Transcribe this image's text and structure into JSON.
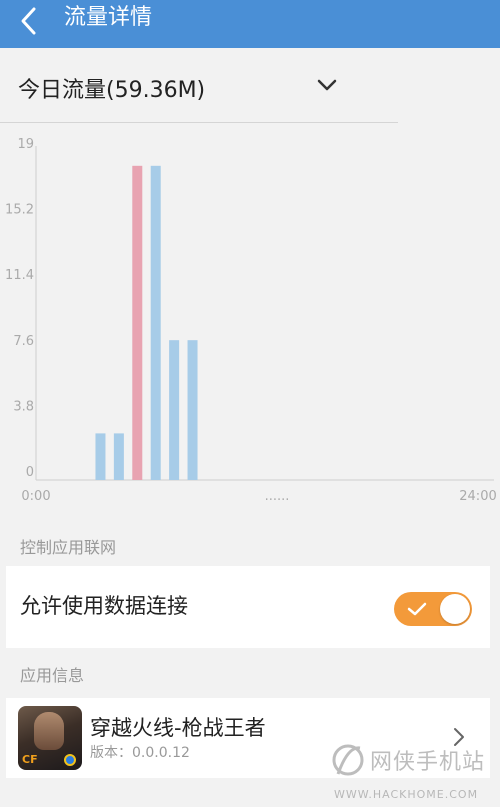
{
  "header": {
    "title": "流量详情",
    "back_icon": "chevron-left-icon"
  },
  "dropdown": {
    "label": "今日流量(59.36M)",
    "icon": "chevron-down-icon"
  },
  "chart_data": {
    "type": "bar",
    "title": "",
    "xlabel": "",
    "ylabel": "",
    "y_ticks": [
      "0",
      "3.8",
      "7.6",
      "11.4",
      "15.2",
      "19"
    ],
    "ylim": [
      0,
      19
    ],
    "x_tick_labels": [
      "0:00",
      "......",
      "24:00"
    ],
    "xlim": [
      0,
      24
    ],
    "bars": [
      {
        "hour": 3,
        "value": 2.7,
        "color": "#a7cce8"
      },
      {
        "hour": 4,
        "value": 2.7,
        "color": "#a7cce8"
      },
      {
        "hour": 5,
        "value": 18.2,
        "color": "#e8a3b1"
      },
      {
        "hour": 6,
        "value": 18.2,
        "color": "#a7cce8"
      },
      {
        "hour": 7,
        "value": 8.1,
        "color": "#a7cce8"
      },
      {
        "hour": 8,
        "value": 8.1,
        "color": "#a7cce8"
      }
    ],
    "colors": {
      "normal": "#a7cce8",
      "highlight": "#e8a3b1"
    }
  },
  "network_section": {
    "title": "控制应用联网",
    "toggle_label": "允许使用数据连接",
    "toggle_on": true,
    "toggle_color": "#f39a3a"
  },
  "app_section": {
    "title": "应用信息",
    "app_name": "穿越火线-枪战王者",
    "version": "版本：0.0.0.12",
    "icon_text": "CF"
  },
  "watermark": {
    "text": "网侠手机站",
    "url": "WWW.HACKHOME.COM"
  },
  "colors": {
    "header": "#4a8fd6",
    "background": "#f2f2f2"
  }
}
